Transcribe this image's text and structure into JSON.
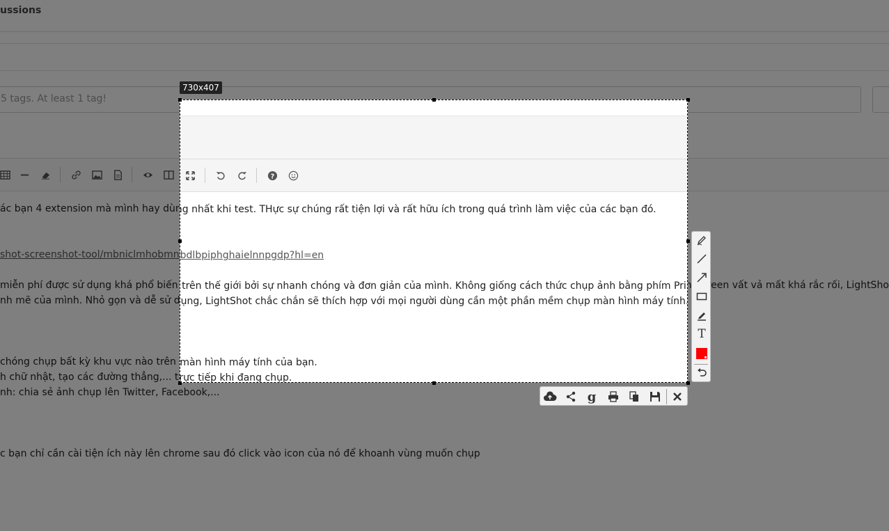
{
  "header": {
    "title": "ussions"
  },
  "tags": {
    "placeholder": "5 tags. At least 1 tag!"
  },
  "size_label": "730x407",
  "content": {
    "line1": "ác bạn 4 extension  mà mình hay dùng nhất khi test. THực sự chúng rất tiện lợi và rất hữu ích trong quá trình làm việc của các bạn đó.",
    "link": "shot-screenshot-tool/mbniclmhobmnbdlbpiphghaielnnpgdp?hl=en",
    "line2": "miễn phí được sử dụng khá phổ biến trên thế giới bởi sự nhanh chóng và đơn giản của mình. Không giống cách thức chụp ảnh bằng phím PrintScreen vất vả mất khá rắc rối, LightShot đem đến cho người",
    "line3": "nh mẽ của mình. Nhỏ gọn và dễ sử dụng, LightShot chắc chắn sẽ thích hợp với mọi người dùng cần một phần mềm chụp màn hình máy tính.",
    "line4": " chóng chụp bất kỳ khu vực nào trên màn hình máy tính của bạn.",
    "line5": "h chữ nhật, tạo các đường thẳng,... trực tiếp khi đang chụp.",
    "line6": "nh: chia sẻ ảnh chụp lên Twitter, Facebook,...",
    "line7": "c bạn chỉ cần cài tiện ích này lên chrome sau đó click vào icon của nó để khoanh vùng muốn chụp"
  },
  "colors": {
    "selected_color": "#ff0000",
    "overlay": "rgba(0,0,0,0.5)"
  }
}
